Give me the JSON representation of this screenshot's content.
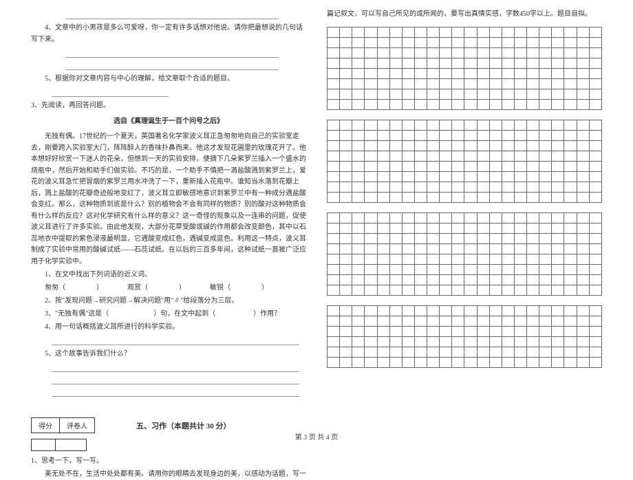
{
  "left": {
    "line_blank_top": "",
    "q4": "4、文章中的小男孩是多么可爱呀，你一定有许多话想对他说。请你把最想说的几句话写下来。",
    "q5": "5、根据你对文章内容与中心的理解，给文章取个合适的题目。",
    "sec3_intro": "3、先阅读，再回答问题。",
    "passage_title": "选自《真理诞生于一百个问号之后》",
    "passage": "无独有偶。17世纪的一个夏天，英国著名化学家波义耳正急匆匆地向自己的实验室走去，刚要跨入实验室大门，阵阵醉人的香味扑鼻而来。他这才发现花圃里的玫瑰花开了。他本想好好欣赏一下迷人的花朵，但想到一天的实验安排，便摘下几朵紫罗兰插入一个盛水的烧瓶中，然后开始和助手们做实验。不巧的是，一个助手不慎把一滴盐酸溅到紫罗兰上，爱花的波义耳急忙把冒烟的紫罗兰用水冲洗了一下，重新插入花瓶中。谁知当水落到花瓣上后，溅上盐酸的花瓣奇迹般地变红了，波义耳立即敏感地意识到紫罗兰中有一种成分遇盐酸会变红。那么，这种物质到底是什么？别的植物会不会有同样的物质？别的酸对这种物质会有什么样的反应？这对化学研究有什么样的意义？这一奇怪的现象以及一连串的问题，促使波义耳进行了许多实验。由此他发现，大部分花草受酸或碱的作用都会改变颜色，其中以石蕊地衣中提取的紫色浸液最明显，它遇酸变成红色，遇碱变成蓝色。利用这一特点，波义耳制成了实验中常用的酸碱试纸——石蕊试纸。在以后的三百多年间，这种试纸一直被广泛应用于化学实验中。",
    "q1_label": "1、在文中找出下列词语的近义词。",
    "q1_words_a": "匆匆（",
    "q1_words_b": "）　　　　观赏（",
    "q1_words_c": "）　　　　敏锐（",
    "q1_words_d": "）",
    "q2": "2、按\"发现问题→研究问题→解决问题\"用\"∥\"给段落分为三层。",
    "q3_a": "3、\"无独有偶\"这是（",
    "q3_b": "）句，在文中起到（",
    "q3_c": "）作用？",
    "q4b": "4、用一句话概括波义耳所进行的科学实验。",
    "q5b": "5、这个故事告诉我们什么？",
    "score_label_a": "得分",
    "score_label_b": "评卷人",
    "section5_heading": "五、习作（本题共计 30 分）",
    "essay_q1": "1、思考一下，写一写。",
    "essay_prompt": "美无处不在，生活中处处都有美。请用你的眼睛去发现身边的美，以感动为话题，写一"
  },
  "right": {
    "essay_continue": "篇记叙文，可以写自己所见的或所闻的，要写出真情实感，字数450字以上。题目自拟。"
  },
  "footer": "第 3 页 共 4 页"
}
